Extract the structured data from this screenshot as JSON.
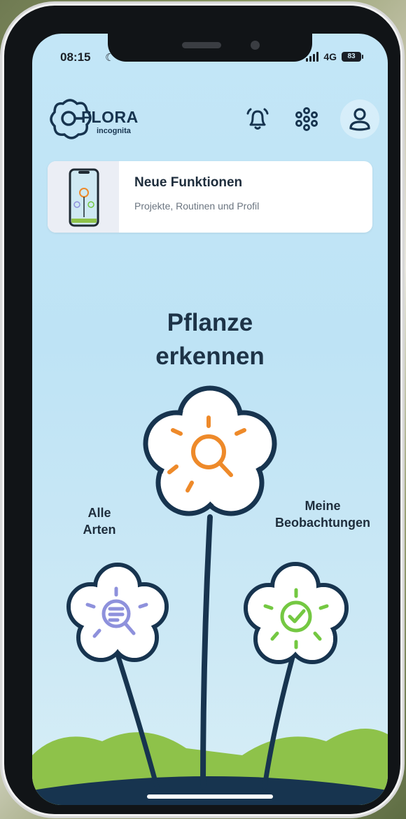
{
  "status_bar": {
    "time": "08:15",
    "network": "4G",
    "battery": "83"
  },
  "header": {
    "logo_word": "FLORA",
    "logo_sub": "incognita",
    "icons": [
      "bell-icon",
      "flower-dots-icon",
      "profile-icon"
    ]
  },
  "news_card": {
    "title": "Neue Funktionen",
    "subtitle": "Projekte, Routinen und Profil"
  },
  "main": {
    "headline_line1": "Pflanze",
    "headline_line2": "erkennen",
    "left_label_line1": "Alle",
    "left_label_line2": "Arten",
    "right_label_line1": "Meine",
    "right_label_line2": "Beobachtungen"
  },
  "colors": {
    "navy": "#17344f",
    "orange": "#ee8a2a",
    "lavender": "#8e91dc",
    "green": "#74c842",
    "sky": "#c3e6f7",
    "grass": "#8ec24a"
  }
}
